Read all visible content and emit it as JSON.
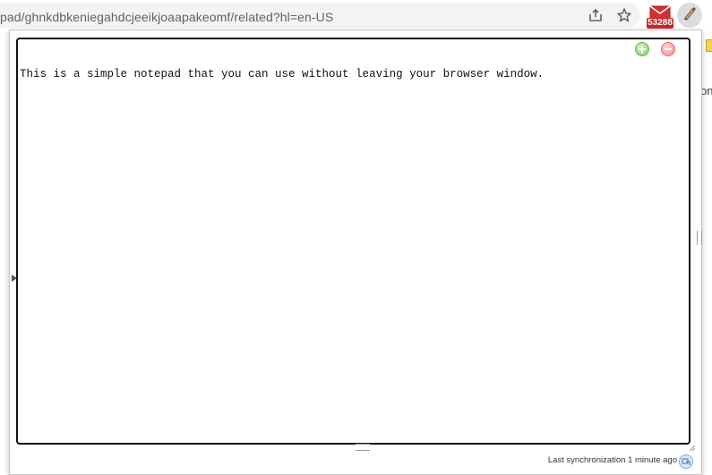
{
  "browser": {
    "url": "pad/ghnkdbkeniegahdcjeeikjoaapakeomf/related?hl=en-US",
    "mail_badge_count": "53288",
    "icons": [
      "share-icon",
      "bookmark-star-icon",
      "mail-icon",
      "notepad-extension-icon"
    ]
  },
  "background_page": {
    "fragment": "on"
  },
  "notepad": {
    "content": "This is a simple notepad that you can use without leaving your browser window.",
    "icons": [
      "add-note-icon",
      "remove-note-icon",
      "sync-icon"
    ],
    "status": "Last synchronization 1 minute ago"
  },
  "colors": {
    "add_button": "#7fcc63",
    "remove_button": "#ee8a8a",
    "mail_badge": "#c62828",
    "frame_border": "#111111"
  }
}
